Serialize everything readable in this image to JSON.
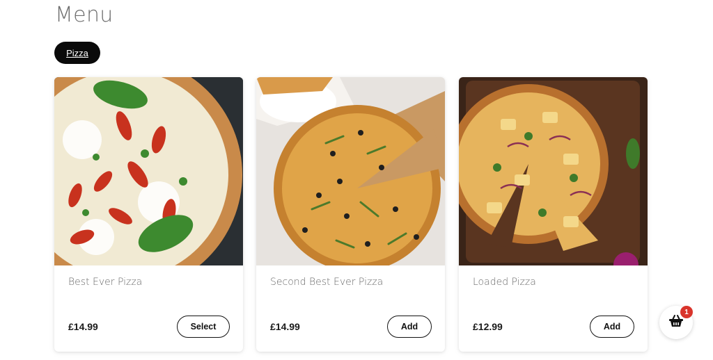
{
  "page": {
    "title": "Menu"
  },
  "categories": [
    {
      "label": "Pizza",
      "active": true
    }
  ],
  "products": [
    {
      "name": "Best Ever Pizza",
      "price": "£14.99",
      "button": "Select",
      "image_icon": "pizza-photo"
    },
    {
      "name": "Second Best Ever Pizza",
      "price": "£14.99",
      "button": "Add",
      "image_icon": "pizza-photo"
    },
    {
      "name": "Loaded Pizza",
      "price": "£12.99",
      "button": "Add",
      "image_icon": "pizza-photo"
    }
  ],
  "cart": {
    "count": "1",
    "icon": "basket-icon",
    "badge_color": "#d9342b"
  },
  "colors": {
    "pill_bg": "#0a0a0a",
    "title": "#6f6f6f",
    "accent": "#111111"
  }
}
